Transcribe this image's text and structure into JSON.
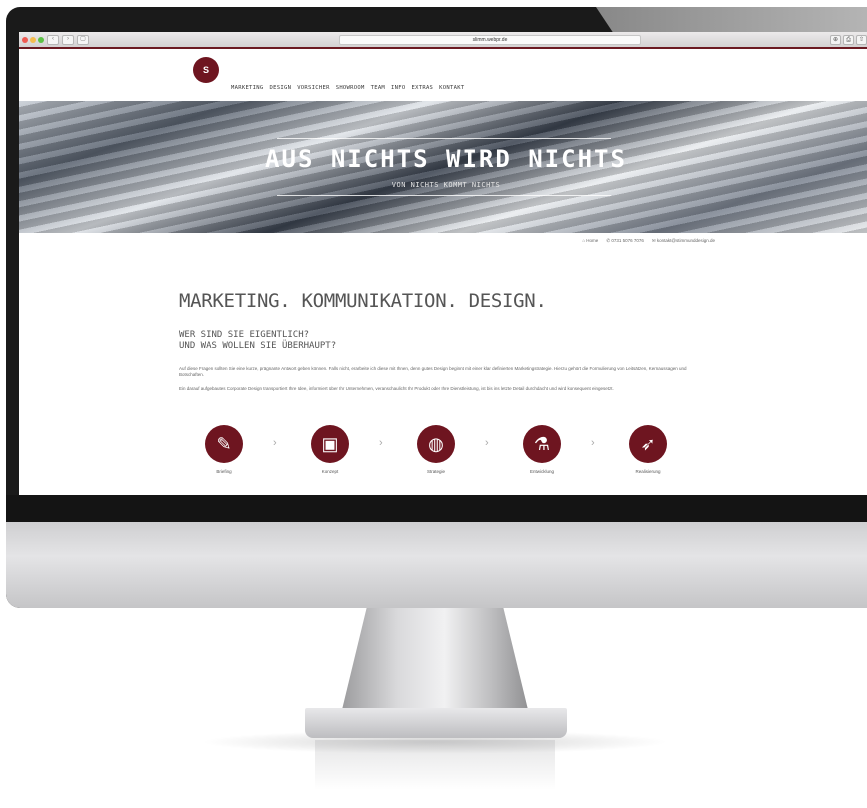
{
  "browser": {
    "url": "slimm.webpr.de",
    "nav_back": "‹",
    "nav_forward": "›",
    "tab_icon": "▢",
    "tools": [
      "⊕",
      "⎙",
      "⇧"
    ]
  },
  "site": {
    "logo_text": "S",
    "menu": [
      "MARKETING",
      "DESIGN",
      "VORSICHER",
      "SHOWROOM",
      "TEAM",
      "INFO",
      "EXTRAS",
      "KONTAKT"
    ],
    "hero_title": "AUS NICHTS WIRD NICHTS",
    "hero_subtitle": "VON NICHTS KOMMT NICHTS",
    "contact": {
      "home": "⌂ Home",
      "phone": "✆ 0731 5076 7076",
      "email": "✉ kontakt@stimmunddesign.de"
    },
    "main_heading": "MARKETING. KOMMUNIKATION. DESIGN.",
    "sub_heading_1": "WER SIND SIE EIGENTLICH?",
    "sub_heading_2": "UND WAS WOLLEN SIE ÜBERHAUPT?",
    "para_1": "Auf diese Fragen sollten Sie eine kurze, prägnante Antwort geben können. Falls nicht, erarbeite ich diese mit Ihnen, denn gutes Design beginnt mit einer klar definierten Marketingstrategie. Hierzu gehört die Formulierung von Leitsätzen, Kernaussagen und Botschaften.",
    "para_2": "Ein darauf aufgebautes Corporate Design transportiert Ihre Idee, informiert über Ihr Unternehmen, veranschaulicht Ihr Produkt oder Ihre Dienstleistung, ist bis ins letzte Detail durchdacht und wird konsequent eingesetzt.",
    "steps": [
      {
        "label": "Briefing",
        "icon": "pencil-icon",
        "glyph": "✎"
      },
      {
        "label": "Konzept",
        "icon": "document-icon",
        "glyph": "▣"
      },
      {
        "label": "Strategie",
        "icon": "lightbulb-icon",
        "glyph": "◍"
      },
      {
        "label": "Entwicklung",
        "icon": "flask-icon",
        "glyph": "⚗"
      },
      {
        "label": "Realisierung",
        "icon": "rocket-icon",
        "glyph": "➶"
      }
    ],
    "arrow": "›"
  },
  "colors": {
    "brand": "#6e1520",
    "dot_close": "#ee5a52",
    "dot_min": "#f5bd4f",
    "dot_max": "#5cc245"
  }
}
